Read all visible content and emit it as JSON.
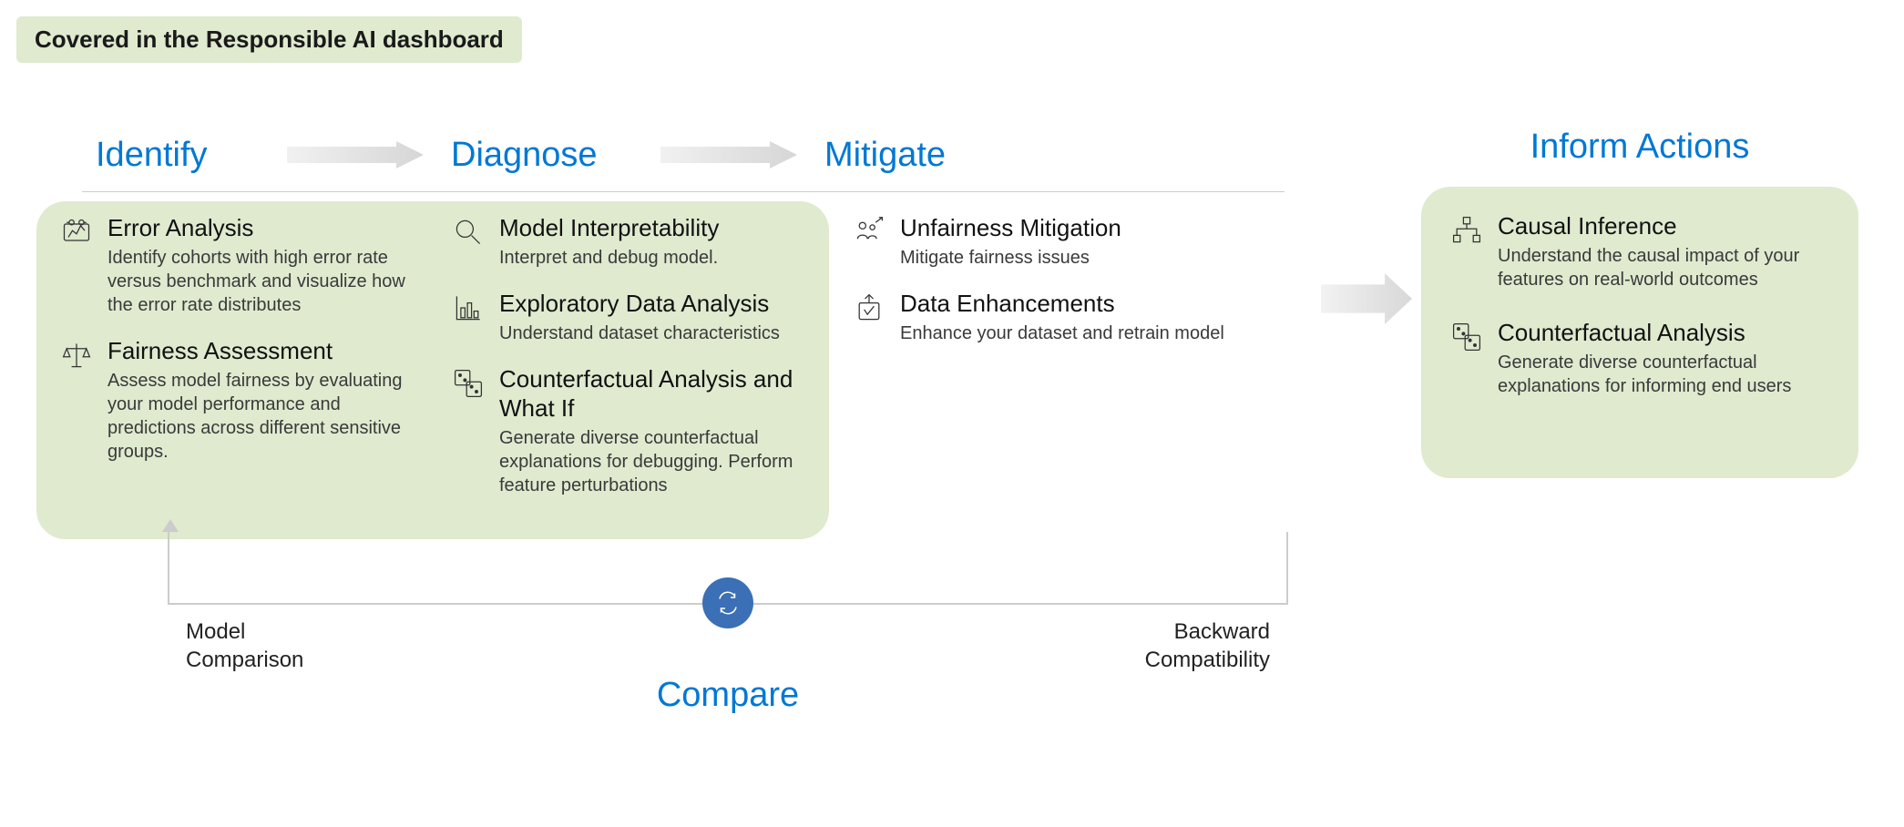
{
  "legend": "Covered in the Responsible AI dashboard",
  "stages": {
    "identify": {
      "title": "Identify",
      "items": [
        {
          "icon": "error-analysis-icon",
          "title": "Error Analysis",
          "desc": "Identify cohorts with high error rate versus benchmark and visualize how the error rate distributes"
        },
        {
          "icon": "fairness-icon",
          "title": "Fairness Assessment",
          "desc": "Assess model fairness by evaluating your model performance and predictions across different sensitive groups."
        }
      ]
    },
    "diagnose": {
      "title": "Diagnose",
      "items": [
        {
          "icon": "magnifier-icon",
          "title": "Model Interpretability",
          "desc": "Interpret and debug model."
        },
        {
          "icon": "chart-icon",
          "title": "Exploratory Data Analysis",
          "desc": "Understand dataset characteristics"
        },
        {
          "icon": "dice-icon",
          "title": "Counterfactual Analysis and What If",
          "desc": "Generate diverse counterfactual explanations for debugging. Perform feature perturbations"
        }
      ]
    },
    "mitigate": {
      "title": "Mitigate",
      "items": [
        {
          "icon": "people-icon",
          "title": "Unfairness Mitigation",
          "desc": "Mitigate fairness issues"
        },
        {
          "icon": "enhance-icon",
          "title": "Data Enhancements",
          "desc": "Enhance your dataset and retrain model"
        }
      ]
    }
  },
  "inform": {
    "title": "Inform Actions",
    "items": [
      {
        "icon": "causal-icon",
        "title": "Causal Inference",
        "desc": "Understand the causal impact of your features on real-world outcomes"
      },
      {
        "icon": "dice-icon",
        "title": "Counterfactual Analysis",
        "desc": "Generate diverse counterfactual explanations for informing end users"
      }
    ]
  },
  "compare": {
    "title": "Compare",
    "left_label_1": "Model",
    "left_label_2": "Comparison",
    "right_label_1": "Backward",
    "right_label_2": "Compatibility"
  }
}
